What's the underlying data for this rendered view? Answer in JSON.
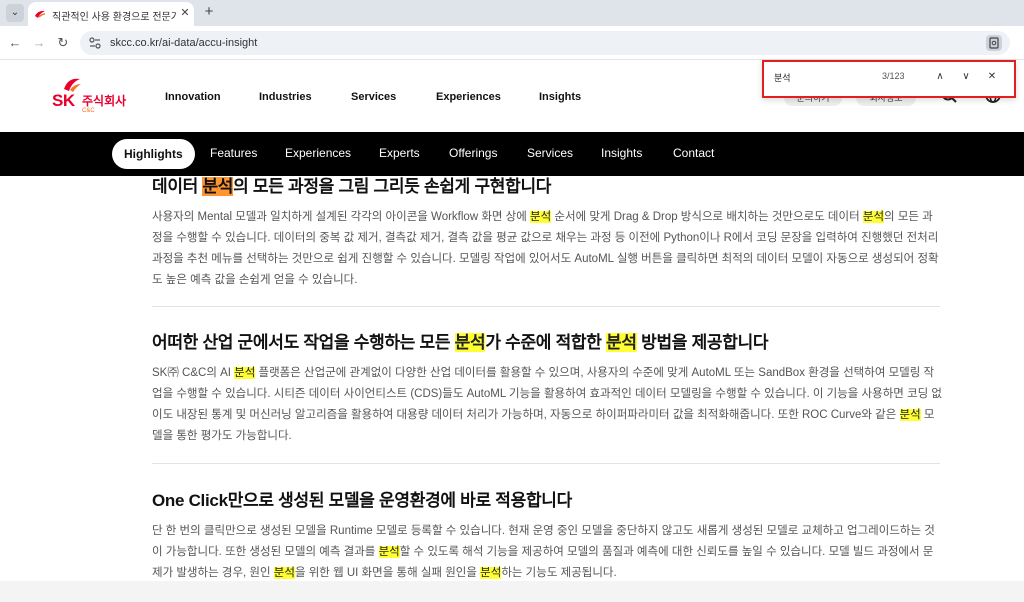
{
  "browser": {
    "tab_title": "직관적인 사용 환경으로 전문가",
    "tab_close": "✕",
    "new_tab": "+",
    "menu": "⌄",
    "back": "←",
    "forward": "→",
    "reload": "↻",
    "url": "skcc.co.kr/ai-data/accu-insight",
    "icons": [
      "chevron-down-icon",
      "favicon-icon",
      "close-icon",
      "plus-icon",
      "back-arrow-icon",
      "forward-arrow-icon",
      "reload-icon",
      "site-info-icon",
      "page-action-icon"
    ]
  },
  "header": {
    "logo": {
      "sk": "SK",
      "text": "주식회사",
      "sub": "C&C"
    },
    "nav": [
      "Innovation",
      "Industries",
      "Services",
      "Experiences",
      "Insights"
    ],
    "pills": [
      "문의하기",
      "회사정보"
    ],
    "icons": [
      "search-icon",
      "globe-icon"
    ]
  },
  "find_bar": {
    "query": "분석",
    "count": "3/123",
    "prev": "∧",
    "next": "∨",
    "close": "✕"
  },
  "subnav": {
    "items": [
      "Highlights",
      "Features",
      "Experiences",
      "Experts",
      "Offerings",
      "Services",
      "Insights",
      "Contact"
    ],
    "active": "Highlights"
  },
  "sections": [
    {
      "title": [
        {
          "t": "데이터 "
        },
        {
          "t": "분석",
          "h": "current"
        },
        {
          "t": "의 모든 과정을 그림 그리듯 손쉽게 구현합니다"
        }
      ],
      "body": [
        {
          "t": "사용자의 Mental 모델과 일치하게 설계된 각각의 아이콘을 Workflow 화면 상에 "
        },
        {
          "t": "분석",
          "h": "match"
        },
        {
          "t": " 순서에 맞게 Drag & Drop 방식으로 배치하는 것만으로도 데이터 "
        },
        {
          "t": "분석",
          "h": "match"
        },
        {
          "t": "의 모든 과정을 수행할 수 있습니다. 데이터의 중복 값 제거, 결측값 제거, 결측 값을 평균 값으로 채우는 과정 등 이전에 Python이나 R에서 코딩 문장을 입력하여 진행했던 전처리 과정을 추천 메뉴를 선택하는 것만으로 쉽게 진행할 수 있습니다. 모델링 작업에 있어서도 AutoML 실행 버튼을 클릭하면 최적의 데이터 모델이 자동으로 생성되어 정확도 높은 예측 값을 손쉽게 얻을 수 있습니다."
        }
      ]
    },
    {
      "title": [
        {
          "t": "어떠한 산업 군에서도 작업을 수행하는 모든 "
        },
        {
          "t": "분석",
          "h": "match"
        },
        {
          "t": "가 수준에 적합한 "
        },
        {
          "t": "분석",
          "h": "match"
        },
        {
          "t": " 방법을 제공합니다"
        }
      ],
      "body": [
        {
          "t": "SK㈜ C&C의 AI "
        },
        {
          "t": "분석",
          "h": "match"
        },
        {
          "t": " 플랫폼은 산업군에 관계없이 다양한 산업 데이터를 활용할 수 있으며, 사용자의 수준에 맞게 AutoML 또는 SandBox 환경을 선택하여 모델링 작업을 수행할 수 있습니다. 시티즌 데이터 사이언티스트 (CDS)들도 AutoML 기능을 활용하여 효과적인 데이터 모델링을 수행할 수 있습니다. 이 기능을 사용하면 코딩 없이도 내장된 통계 및 머신러닝 알고리즘을 활용하여 대용량 데이터 처리가 가능하며, 자동으로 하이퍼파라미터 값을 최적화해줍니다. 또한 ROC Curve와 같은 "
        },
        {
          "t": "분석",
          "h": "match"
        },
        {
          "t": " 모델을 통한 평가도 가능합니다."
        }
      ]
    },
    {
      "title": [
        {
          "t": "One Click만으로 생성된 모델을 운영환경에 바로 적용합니다"
        }
      ],
      "body": [
        {
          "t": "단 한 번의 클릭만으로 생성된 모델을 Runtime 모델로 등록할 수 있습니다. 현재 운영 중인 모델을 중단하지 않고도 새롭게 생성된 모델로 교체하고 업그레이드하는 것이 가능합니다. 또한 생성된 모델의 예측 결과를 "
        },
        {
          "t": "분석",
          "h": "match"
        },
        {
          "t": "할 수 있도록 해석 기능을 제공하여 모델의 품질과 예측에 대한 신뢰도를 높일 수 있습니다. 모델 빌드 과정에서 문제가 발생하는 경우, 원인 "
        },
        {
          "t": "분석",
          "h": "match"
        },
        {
          "t": "을 위한 웹 UI 화면을 통해 실패 원인을 "
        },
        {
          "t": "분석",
          "h": "match"
        },
        {
          "t": "하는 기능도 제공됩니다."
        }
      ]
    }
  ],
  "colors": {
    "brand_red": "#ea002c",
    "brand_orange": "#f47725",
    "match_highlight": "#ffff33",
    "current_highlight": "#ff9632",
    "subnav_bg": "#000000",
    "find_border": "#e02020"
  }
}
